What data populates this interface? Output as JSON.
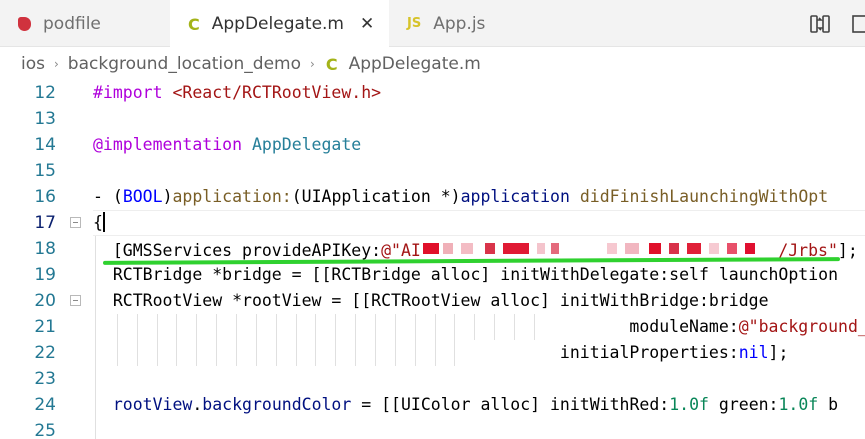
{
  "tabs": [
    {
      "label": "podfile",
      "icon": "ruby-icon",
      "active": false
    },
    {
      "label": "AppDelegate.m",
      "icon": "c-file-icon",
      "icon_text": "C",
      "active": true,
      "close": "✕"
    },
    {
      "label": "App.js",
      "icon": "js-file-icon",
      "icon_text": "JS",
      "active": false
    }
  ],
  "breadcrumb": {
    "items": [
      "ios",
      "background_location_demo",
      "AppDelegate.m"
    ],
    "separator": "›",
    "file_icon_text": "C"
  },
  "editor": {
    "lines": [
      {
        "n": "12",
        "tokens": [
          [
            "kw",
            "#import "
          ],
          [
            "str",
            "<React/RCTRootView.h>"
          ]
        ]
      },
      {
        "n": "13",
        "tokens": []
      },
      {
        "n": "14",
        "tokens": [
          [
            "kw",
            "@implementation "
          ],
          [
            "cls",
            "AppDelegate"
          ]
        ]
      },
      {
        "n": "15",
        "tokens": []
      },
      {
        "n": "16",
        "tokens": [
          [
            "plain",
            "- ("
          ],
          [
            "typ",
            "BOOL"
          ],
          [
            "plain",
            ")"
          ],
          [
            "fn",
            "application:"
          ],
          [
            "plain",
            "(UIApplication *)"
          ],
          [
            "var",
            "application "
          ],
          [
            "fn",
            "didFinishLaunchingWithOpt"
          ]
        ]
      },
      {
        "n": "17",
        "tokens": [
          [
            "plain",
            "{"
          ]
        ]
      },
      {
        "n": "18",
        "tokens": [
          [
            "plain",
            "  [GMSServices provideAPIKey:"
          ],
          [
            "str",
            "@\"AI"
          ],
          [
            "mask",
            ""
          ],
          [
            "str",
            "/Jrbs\""
          ],
          [
            "plain",
            "];"
          ]
        ]
      },
      {
        "n": "19",
        "tokens": [
          [
            "plain",
            "  RCTBridge *bridge = [[RCTBridge alloc] initWithDelegate:self launchOption"
          ]
        ]
      },
      {
        "n": "20",
        "tokens": [
          [
            "plain",
            "  RCTRootView *rootView = [[RCTRootView alloc] initWithBridge:bridge"
          ]
        ]
      },
      {
        "n": "21",
        "tokens": [
          [
            "plain",
            "                                                      moduleName:"
          ],
          [
            "str",
            "@\"background_"
          ]
        ]
      },
      {
        "n": "22",
        "tokens": [
          [
            "plain",
            "                                               initialProperties:"
          ],
          [
            "typ",
            "nil"
          ],
          [
            "plain",
            "];"
          ]
        ]
      },
      {
        "n": "23",
        "tokens": []
      },
      {
        "n": "24",
        "tokens": [
          [
            "plain",
            "  "
          ],
          [
            "var",
            "rootView"
          ],
          [
            "plain",
            "."
          ],
          [
            "var",
            "backgroundColor"
          ],
          [
            "plain",
            " = [[UIColor alloc] initWithRed:"
          ],
          [
            "num",
            "1.0f"
          ],
          [
            "plain",
            " green:"
          ],
          [
            "num",
            "1.0f"
          ],
          [
            "plain",
            " b"
          ]
        ]
      },
      {
        "n": "25",
        "tokens": []
      }
    ]
  },
  "colors": {
    "keyword": "#af00db",
    "string": "#a31515",
    "type": "#0000ff",
    "function": "#795e26",
    "class": "#267f99",
    "number": "#098658",
    "line_number": "#237893",
    "highlight_underline": "#2fd12f"
  }
}
